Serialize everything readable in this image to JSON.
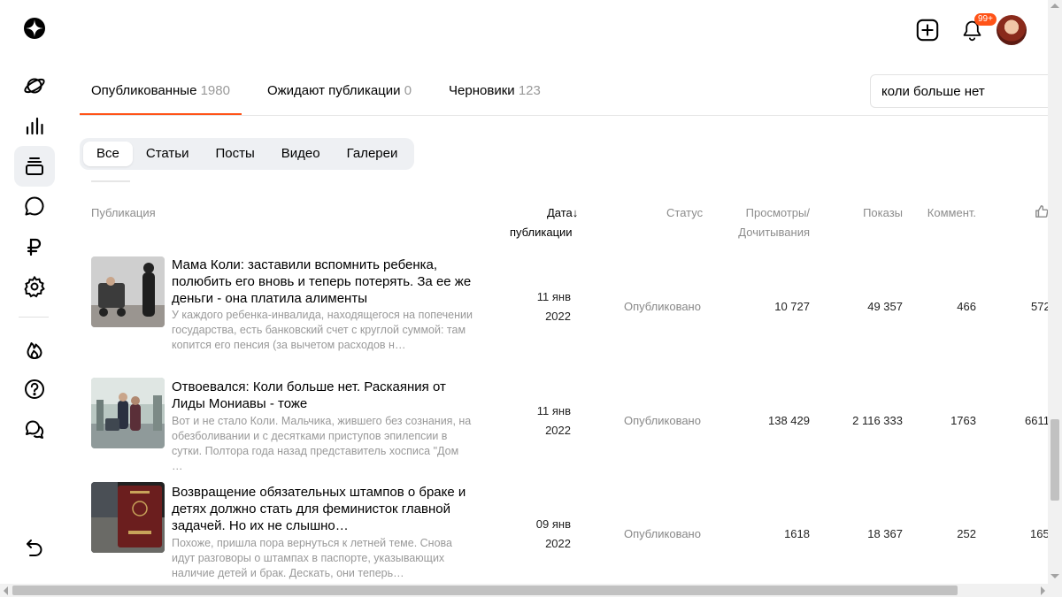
{
  "sidebar": {
    "items": [
      {
        "icon": "logo-icon"
      },
      {
        "icon": "planet-icon"
      },
      {
        "icon": "stats-icon"
      },
      {
        "icon": "publications-icon"
      },
      {
        "icon": "comments-icon"
      },
      {
        "icon": "ruble-icon"
      },
      {
        "icon": "settings-icon"
      },
      {
        "icon": "fire-icon"
      },
      {
        "icon": "help-icon"
      },
      {
        "icon": "chat-icon"
      },
      {
        "icon": "back-icon"
      }
    ]
  },
  "header": {
    "notifications_badge": "99+"
  },
  "tabs": [
    {
      "label": "Опубликованные",
      "count": "1980"
    },
    {
      "label": "Ожидают публикации",
      "count": "0"
    },
    {
      "label": "Черновики",
      "count": "123"
    }
  ],
  "search": {
    "value": "коли больше нет"
  },
  "filters": [
    "Все",
    "Статьи",
    "Посты",
    "Видео",
    "Галереи"
  ],
  "columns": {
    "publication": "Публикация",
    "date_1": "Дата",
    "date_2": "публикации",
    "status": "Статус",
    "views_1": "Просмотры/",
    "views_2": "Дочитывания",
    "impressions": "Показы",
    "comments": "Коммент."
  },
  "rows": [
    {
      "title": "Мама Коли: заставили вспомнить ребенка, полюбить его вновь и теперь потерять. За ее же деньги - она платила алименты",
      "desc": "У каждого ребенка-инвалида, находящегося на попечении государства, есть банковский счет с круглой суммой: там копится его пенсия (за вычетом расходов н…",
      "date_day": "11 янв",
      "date_year": "2022",
      "status": "Опубликовано",
      "views": "10 727",
      "impressions": "49 357",
      "comments": "466",
      "likes": "572"
    },
    {
      "title": "Отвоевался: Коли больше нет. Раскаяния от Лиды Мониавы - тоже",
      "desc": "Вот и не стало Коли. Мальчика, жившего без сознания, на обезболивании и с десятками приступов эпилепсии в сутки. Полтора года назад представитель хосписа \"Дом …",
      "date_day": "11 янв",
      "date_year": "2022",
      "status": "Опубликовано",
      "views": "138 429",
      "impressions": "2 116 333",
      "comments": "1763",
      "likes": "6611"
    },
    {
      "title": "Возвращение обязательных штампов о браке и детях должно стать для феминисток главной задачей. Но их не слышно…",
      "desc": "Похоже, пришла пора вернуться к летней теме. Снова идут разговоры о штампах в паспорте, указывающих наличие детей и брак. Дескать, они теперь…",
      "date_day": "09 янв",
      "date_year": "2022",
      "status": "Опубликовано",
      "views": "1618",
      "impressions": "18 367",
      "comments": "252",
      "likes": "165"
    }
  ]
}
